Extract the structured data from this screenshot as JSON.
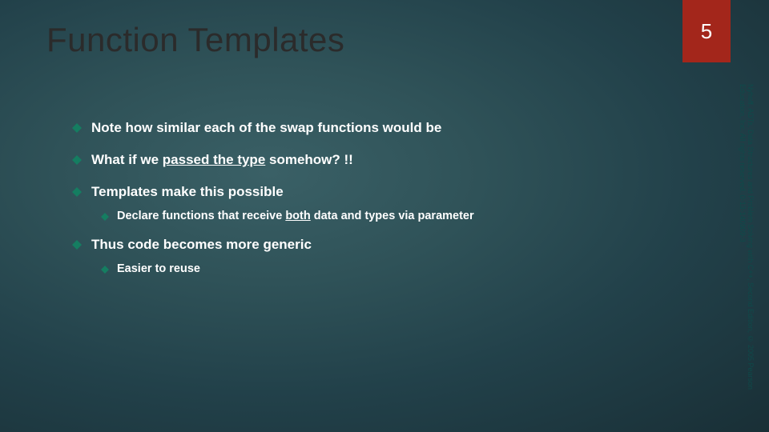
{
  "header": {
    "title": "Function Templates",
    "page_number": "5"
  },
  "attribution": "Nyhoff, ADTs, Data Structures and Problem Solving with C++, Second Edition, © 2005 Pearson Education, Inc. All rights reserved. 0-13-140909-3",
  "bullets": {
    "b1": "Note how similar each of the swap functions would be",
    "b2_a": "What if we ",
    "b2_u": "passed the type",
    "b2_b": " somehow? !!",
    "b3": "Templates make this possible",
    "b3_1_a": "Declare functions that receive ",
    "b3_1_u": "both",
    "b3_1_b": " data and types via parameter",
    "b4": "Thus code becomes more generic",
    "b4_1": "Easier to reuse"
  },
  "colors": {
    "accent": "#a3261b",
    "bullet": "#157d61"
  }
}
